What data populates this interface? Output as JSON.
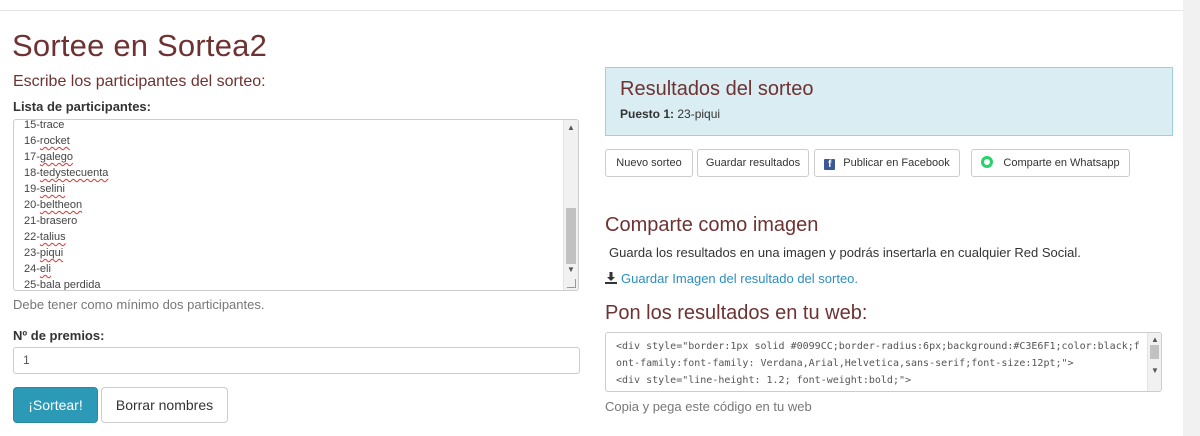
{
  "page": {
    "title": "Sortee en Sortea2",
    "subtitle": "Escribe los participantes del sorteo:"
  },
  "participants": {
    "label": "Lista de participantes:",
    "lines": [
      {
        "num": "15-",
        "name": "trace",
        "flag": false
      },
      {
        "num": "16-",
        "name": "rocket",
        "flag": true
      },
      {
        "num": "17-",
        "name": "galego",
        "flag": true
      },
      {
        "num": "18-",
        "name": "tedystecuenta",
        "flag": true
      },
      {
        "num": "19-",
        "name": "selini",
        "flag": true
      },
      {
        "num": "20-",
        "name": "beltheon",
        "flag": true
      },
      {
        "num": "21-",
        "name": "brasero",
        "flag": false
      },
      {
        "num": "22-",
        "name": "talius",
        "flag": true
      },
      {
        "num": "23-",
        "name": "piqui",
        "flag": true
      },
      {
        "num": "24-",
        "name": "eli",
        "flag": true
      },
      {
        "num": "25-",
        "name": "bala perdida",
        "flag": false
      }
    ],
    "help": "Debe tener como mínimo dos participantes."
  },
  "prizes": {
    "label": "Nº de premios:",
    "value": "1"
  },
  "buttons": {
    "draw": "¡Sortear!",
    "clear": "Borrar nombres"
  },
  "results": {
    "title": "Resultados del sorteo",
    "position_label": "Puesto 1:",
    "position_value": "23-piqui"
  },
  "share_buttons": {
    "new_draw": "Nuevo sorteo",
    "save": "Guardar resultados",
    "facebook": "Publicar en Facebook",
    "whatsapp": "Comparte en Whatsapp"
  },
  "image_share": {
    "heading": "Comparte como imagen",
    "description": "Guarda los resultados en una imagen y podrás insertarla en cualquier Red Social.",
    "link": "Guardar Imagen del resultado del sorteo."
  },
  "embed": {
    "heading": "Pon los resultados en tu web:",
    "code": "<div style=\"border:1px solid #0099CC;border-radius:6px;background:#C3E6F1;color:black;font-family:font-family: Verdana,Arial,Helvetica,sans-serif;font-size:12pt;\">\n<div style=\"line-height: 1.2; font-weight:bold;\">",
    "hint": "Copia y pega este código en tu web"
  },
  "colors": {
    "heading": "#6e3232",
    "primary": "#2c9ab7",
    "results_bg": "#d9edf3",
    "link": "#2c8ec0"
  }
}
